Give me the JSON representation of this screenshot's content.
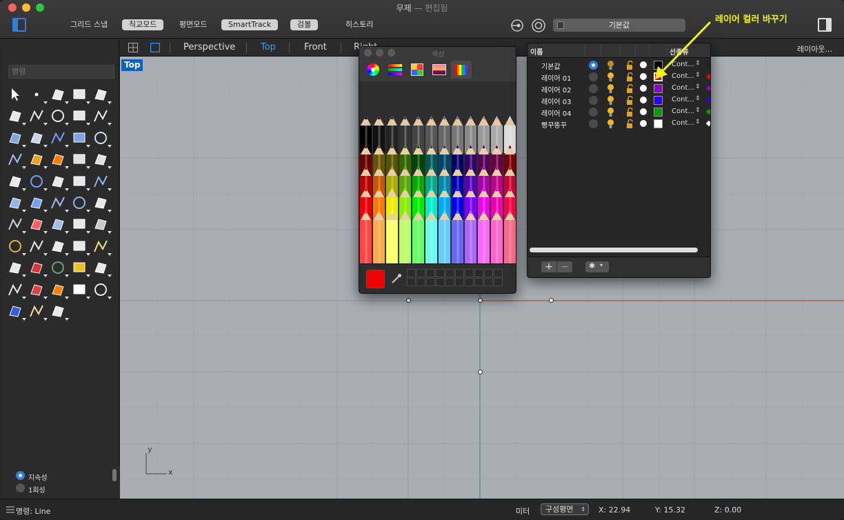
{
  "window": {
    "title": "무제",
    "title_separator": "—",
    "title_status": "편집됨"
  },
  "toolbar": {
    "buttons": [
      {
        "label": "그리드 스냅",
        "active": false
      },
      {
        "label": "직교모드",
        "active": true
      },
      {
        "label": "평면모드",
        "active": false
      },
      {
        "label": "SmartTrack",
        "active": true
      },
      {
        "label": "검볼",
        "active": true
      },
      {
        "label": "히스토리",
        "active": false
      }
    ],
    "current_layer": "기본값"
  },
  "annotation": {
    "text": "레이어 컬러 바꾸기",
    "color": "#f2f21a"
  },
  "viewport_tabs": [
    "Perspective",
    "Top",
    "Front",
    "Right"
  ],
  "viewport_tabs_active": "Top",
  "viewport_tabs_right": "레이아웃...",
  "left_panel": {
    "command_placeholder": "명령",
    "osnap_options": [
      {
        "label": "지속성",
        "selected": true
      },
      {
        "label": "1회성",
        "selected": false
      }
    ]
  },
  "viewport": {
    "label": "Top",
    "axis_y": "y",
    "axis_x": "x",
    "background": "#a9aeb4"
  },
  "color_panel": {
    "title": "색상",
    "current_color": "#f00000",
    "tabs": [
      "color-wheel-icon",
      "color-sliders-icon",
      "color-palettes-icon",
      "image-palettes-icon",
      "pencils-icon"
    ]
  },
  "layers_panel": {
    "headers": [
      "이름",
      "선종류"
    ],
    "layers": [
      {
        "name": "기본값",
        "current": true,
        "color": "#000000",
        "linetype": "Cont..."
      },
      {
        "name": "레이어 01",
        "current": false,
        "color": "#e60000",
        "linetype": "Cont..."
      },
      {
        "name": "레이어 02",
        "current": false,
        "color": "#9400d3",
        "linetype": "Cont..."
      },
      {
        "name": "레이어 03",
        "current": false,
        "color": "#2a00ff",
        "linetype": "Cont..."
      },
      {
        "name": "레이어 04",
        "current": false,
        "color": "#00a000",
        "linetype": "Cont..."
      },
      {
        "name": "빵꾸똥꾸",
        "current": false,
        "color": "#ffffff",
        "linetype": "Cont..."
      }
    ]
  },
  "statusbar": {
    "command": "명령: Line",
    "units": "미터",
    "cplane": "구성평면",
    "x": "X: 22.94",
    "y": "Y: 15.32",
    "z": "Z: 0.00"
  }
}
